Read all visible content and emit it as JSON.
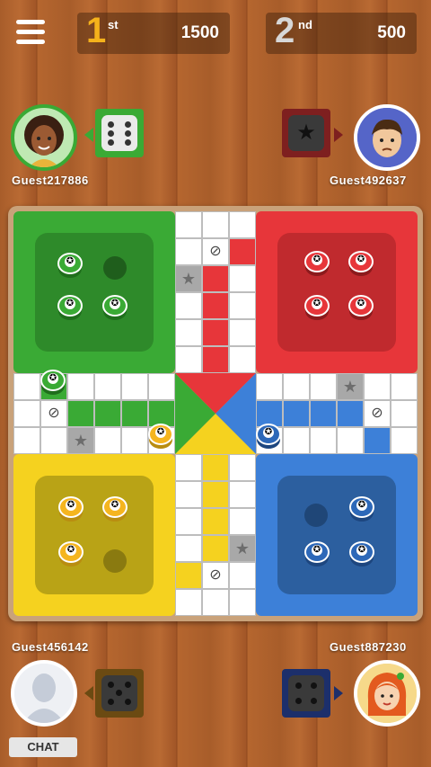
{
  "colors": {
    "green": "#3aaa35",
    "red": "#e7363a",
    "yellow": "#f5d21f",
    "blue": "#3d80d8"
  },
  "topbar": {
    "menu_icon": "hamburger-menu-icon",
    "first": {
      "rank": "1",
      "suffix": "st",
      "score": "1500"
    },
    "second": {
      "rank": "2",
      "suffix": "nd",
      "score": "500"
    }
  },
  "players": {
    "top_left": {
      "name": "Guest217886",
      "dice_value": 6,
      "color": "green"
    },
    "top_right": {
      "name": "Guest492637",
      "dice_icon": "star-icon",
      "color": "red"
    },
    "bottom_left": {
      "name": "Guest456142",
      "dice_value": 5,
      "color": "yellow"
    },
    "bottom_right": {
      "name": "Guest887230",
      "dice_value": 4,
      "color": "blue"
    }
  },
  "chat": {
    "label": "CHAT"
  }
}
